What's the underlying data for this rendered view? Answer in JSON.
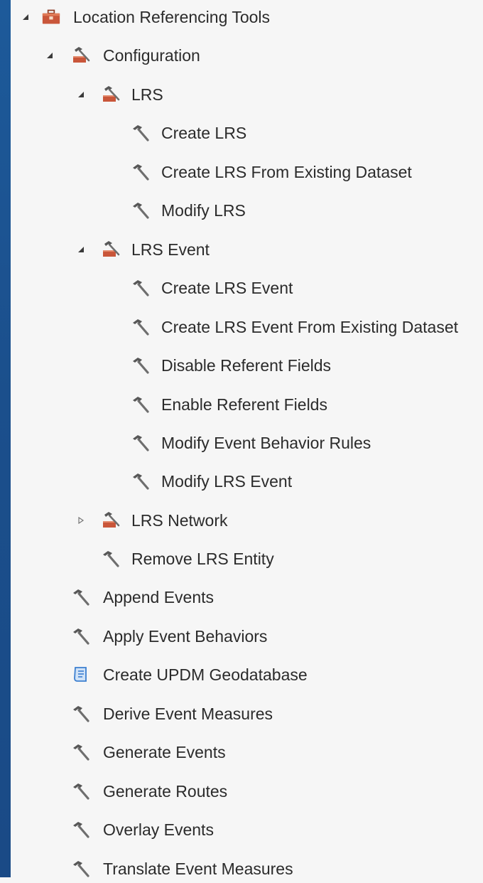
{
  "tree": {
    "nodes": [
      {
        "label": "Location Referencing Tools",
        "icon": "toolbox-icon",
        "expander": "expanded"
      },
      {
        "label": "Configuration",
        "icon": "toolset-icon",
        "expander": "expanded"
      },
      {
        "label": "LRS",
        "icon": "toolset-icon",
        "expander": "expanded"
      },
      {
        "label": "Create LRS",
        "icon": "hammer-tool-icon"
      },
      {
        "label": "Create LRS From Existing Dataset",
        "icon": "hammer-tool-icon"
      },
      {
        "label": "Modify LRS",
        "icon": "hammer-tool-icon"
      },
      {
        "label": "LRS Event",
        "icon": "toolset-icon",
        "expander": "expanded"
      },
      {
        "label": "Create LRS Event",
        "icon": "hammer-tool-icon"
      },
      {
        "label": "Create LRS Event From Existing Dataset",
        "icon": "hammer-tool-icon"
      },
      {
        "label": "Disable Referent Fields",
        "icon": "hammer-tool-icon"
      },
      {
        "label": "Enable Referent Fields",
        "icon": "hammer-tool-icon"
      },
      {
        "label": "Modify Event Behavior Rules",
        "icon": "hammer-tool-icon"
      },
      {
        "label": "Modify LRS Event",
        "icon": "hammer-tool-icon"
      },
      {
        "label": "LRS Network",
        "icon": "toolset-icon",
        "expander": "collapsed"
      },
      {
        "label": "Remove LRS Entity",
        "icon": "hammer-tool-icon"
      },
      {
        "label": "Append Events",
        "icon": "hammer-tool-icon"
      },
      {
        "label": "Apply Event Behaviors",
        "icon": "hammer-tool-icon"
      },
      {
        "label": "Create UPDM Geodatabase",
        "icon": "script-tool-icon"
      },
      {
        "label": "Derive Event Measures",
        "icon": "hammer-tool-icon"
      },
      {
        "label": "Generate Events",
        "icon": "hammer-tool-icon"
      },
      {
        "label": "Generate Routes",
        "icon": "hammer-tool-icon"
      },
      {
        "label": "Overlay Events",
        "icon": "hammer-tool-icon"
      },
      {
        "label": "Translate Event Measures",
        "icon": "hammer-tool-icon"
      }
    ]
  },
  "colors": {
    "page_background": "#f6f6f6",
    "left_edge": "#1b4f8c",
    "text": "#2b2b2b",
    "hammer_handle": "#6e6e6e",
    "toolbox": "#c9563a",
    "script": "#3c7fd0"
  }
}
